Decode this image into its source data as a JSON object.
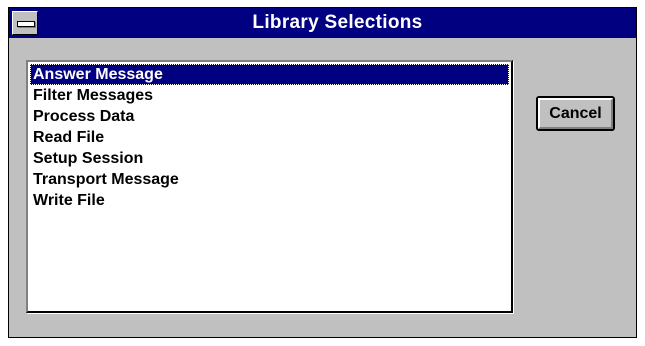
{
  "window": {
    "title": "Library Selections",
    "titlebar_color": "#000080",
    "face_color": "#c0c0c0"
  },
  "titlebar": {
    "system_menu_icon": "system-menu-icon"
  },
  "list": {
    "items": [
      "Answer Message",
      "Filter Messages",
      "Process Data",
      "Read File",
      "Setup Session",
      "Transport Message",
      "Write File"
    ],
    "selected": "Answer Message",
    "selection_color": "#000080"
  },
  "buttons": {
    "cancel_label": "Cancel"
  }
}
